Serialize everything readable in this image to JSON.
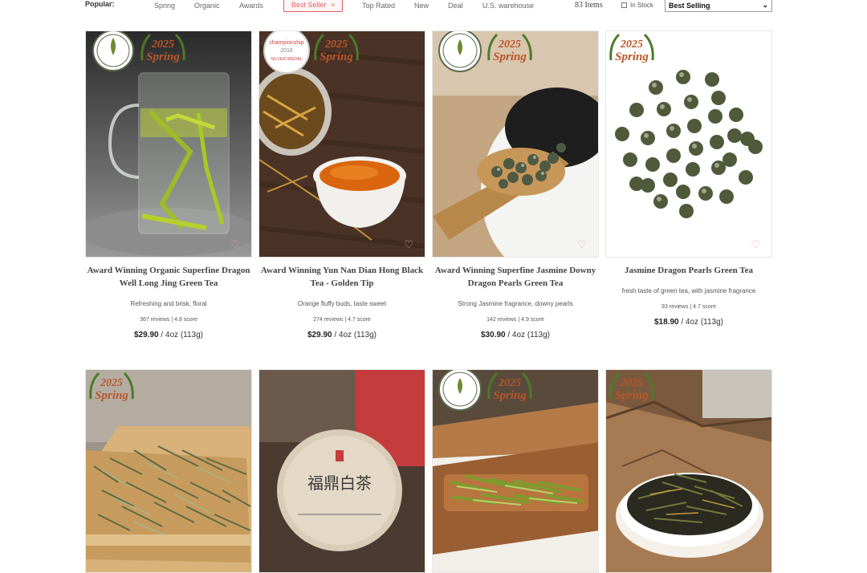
{
  "filters": {
    "popular_label": "Popular:",
    "chips": [
      "Spring",
      "Organic",
      "Awards",
      "Best Seller",
      "Top Rated",
      "New",
      "Deal",
      "U.S. warehouse"
    ],
    "active_chip": "Best Seller",
    "active_chip_close": "×",
    "items_count": "83 Items",
    "in_stock_label": "In Stock",
    "in_stock_checked": false,
    "sort_value": "Best Selling"
  },
  "badges": {
    "spring_year": "2025",
    "spring_word": "Spring",
    "medal_text": "SILVER MEDAL",
    "medal_year": "2018",
    "medal_title": "championship"
  },
  "colors": {
    "accent": "#e06060",
    "spring_badge": "#b8562a",
    "heart": "#ec9aa6"
  },
  "products": [
    {
      "title": "Award Winning Organic Superfine Dragon Well Long Jing Green Tea",
      "description": "Refreshing and brisk, floral",
      "reviews": "367 reviews | 4.8 score",
      "price": "$29.90",
      "unit": " / 4oz (113g)"
    },
    {
      "title": "Award Winning Yun Nan Dian Hong Black Tea - Golden Tip",
      "description": "Orange fluffy buds, taste sweet",
      "reviews": "274 reviews | 4.7 score",
      "price": "$29.90",
      "unit": " / 4oz (113g)"
    },
    {
      "title": "Award Winning Superfine Jasmine Downy Dragon Pearls Green Tea",
      "description": "Strong Jasmine fragrance, downy pearls",
      "reviews": "142 reviews | 4.9 score",
      "price": "$30.90",
      "unit": " / 4oz (113g)"
    },
    {
      "title": "Jasmine Dragon Pearls Green Tea",
      "description": "fresh taste of green tea, with jasmine fragrance",
      "reviews": "93 reviews | 4.7 score",
      "price": "$18.90",
      "unit": " / 4oz (113g)"
    }
  ],
  "row2": {
    "cake_label": "福鼎白茶"
  }
}
